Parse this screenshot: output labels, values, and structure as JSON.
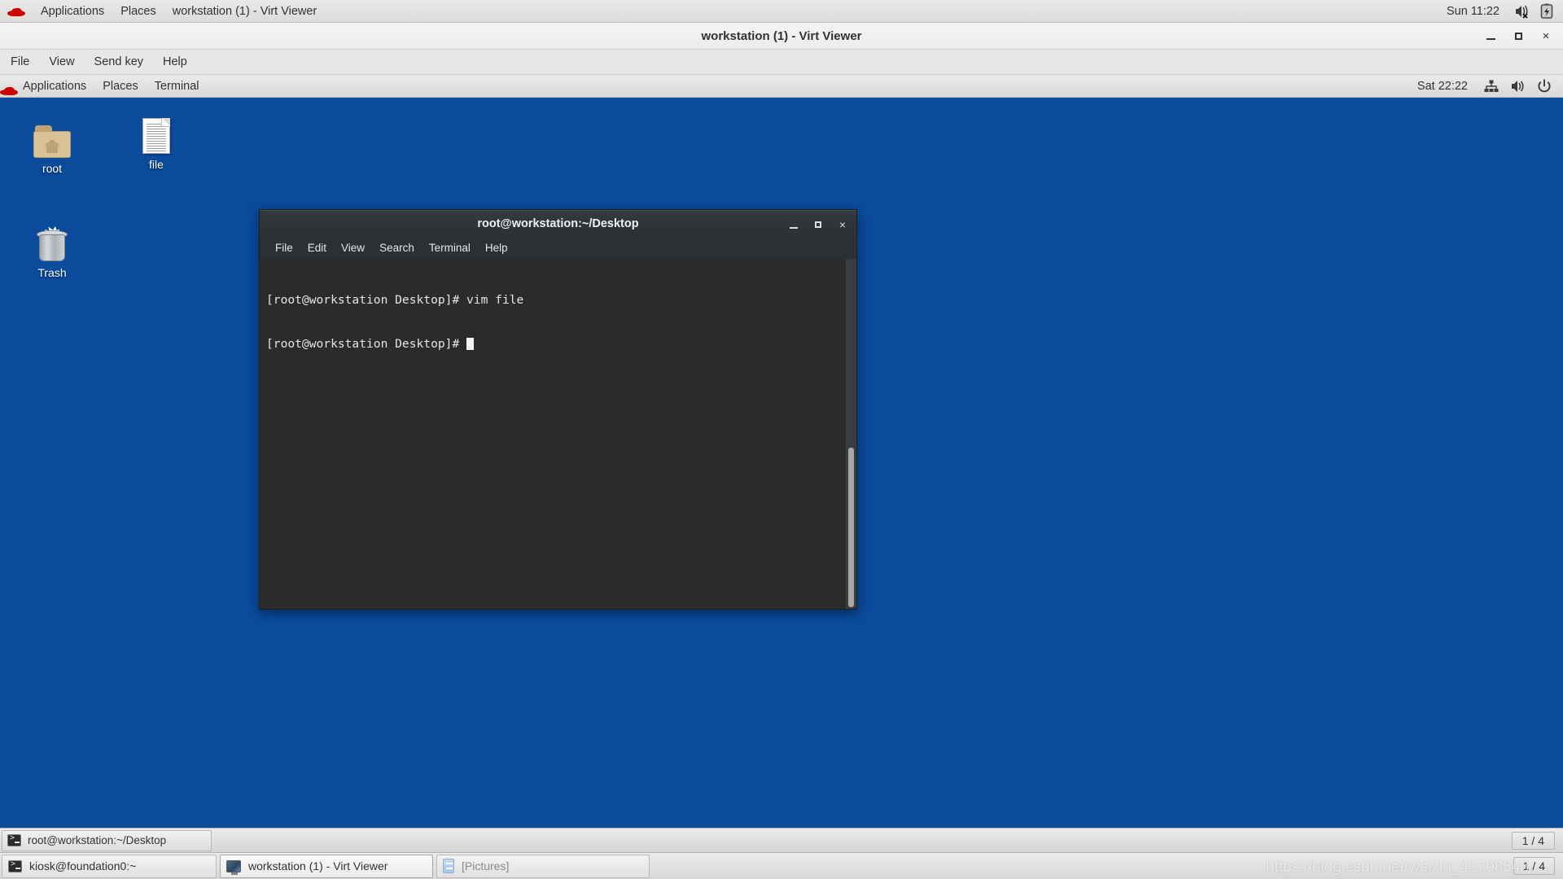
{
  "host_panel": {
    "logo": "redhat-logo",
    "items": [
      {
        "label": "Applications",
        "name": "host-menu-applications"
      },
      {
        "label": "Places",
        "name": "host-menu-places"
      },
      {
        "label": "workstation (1) - Virt Viewer",
        "name": "host-window-menu"
      }
    ],
    "clock": "Sun 11:22",
    "tray": [
      {
        "icon": "speaker-muted-icon"
      },
      {
        "icon": "battery-charging-icon"
      }
    ]
  },
  "virt_viewer": {
    "title": "workstation (1) - Virt Viewer",
    "window_buttons": {
      "minimize": "minimize-button",
      "maximize": "maximize-button",
      "close": "×"
    },
    "menu": [
      {
        "label": "File",
        "name": "vv-menu-file"
      },
      {
        "label": "View",
        "name": "vv-menu-view"
      },
      {
        "label": "Send key",
        "name": "vv-menu-send-key"
      },
      {
        "label": "Help",
        "name": "vv-menu-help"
      }
    ]
  },
  "guest_panel": {
    "logo": "redhat-logo",
    "items": [
      {
        "label": "Applications",
        "name": "guest-menu-applications"
      },
      {
        "label": "Places",
        "name": "guest-menu-places"
      },
      {
        "label": "Terminal",
        "name": "guest-window-menu"
      }
    ],
    "clock": "Sat 22:22",
    "tray": [
      {
        "icon": "network-wired-icon"
      },
      {
        "icon": "volume-icon"
      },
      {
        "icon": "power-icon"
      }
    ]
  },
  "desktop": {
    "background_color": "#0a4b9c",
    "icons": [
      {
        "label": "root",
        "icon": "home-folder-icon",
        "name": "desktop-icon-root"
      },
      {
        "label": "file",
        "icon": "document-icon",
        "name": "desktop-icon-file"
      },
      {
        "label": "Trash",
        "icon": "trash-icon",
        "name": "desktop-icon-trash"
      }
    ]
  },
  "terminal": {
    "title": "root@workstation:~/Desktop",
    "window_buttons": {
      "minimize": "minimize-button",
      "maximize": "maximize-button",
      "close": "×"
    },
    "menu": [
      {
        "label": "File",
        "name": "term-menu-file"
      },
      {
        "label": "Edit",
        "name": "term-menu-edit"
      },
      {
        "label": "View",
        "name": "term-menu-view"
      },
      {
        "label": "Search",
        "name": "term-menu-search"
      },
      {
        "label": "Terminal",
        "name": "term-menu-terminal"
      },
      {
        "label": "Help",
        "name": "term-menu-help"
      }
    ],
    "lines": [
      "[root@workstation Desktop]# vim file",
      "[root@workstation Desktop]# "
    ],
    "background_color": "#2b2b2b",
    "foreground_color": "#e4e4e4"
  },
  "guest_taskbar": {
    "items": [
      {
        "label": "root@workstation:~/Desktop",
        "icon": "terminal-icon",
        "name": "guest-task-terminal"
      }
    ],
    "workspace_indicator": "1 / 4"
  },
  "host_taskbar": {
    "items": [
      {
        "label": "kiosk@foundation0:~",
        "icon": "terminal-icon",
        "name": "host-task-kiosk-terminal"
      },
      {
        "label": "workstation (1) - Virt Viewer",
        "icon": "monitor-icon",
        "name": "host-task-virt-viewer"
      },
      {
        "label": "[Pictures]",
        "icon": "pictures-icon",
        "name": "host-task-pictures"
      }
    ],
    "workspace_indicator": "1 / 4"
  },
  "watermark": "https://blog.csdn.net/weixin_41708548"
}
